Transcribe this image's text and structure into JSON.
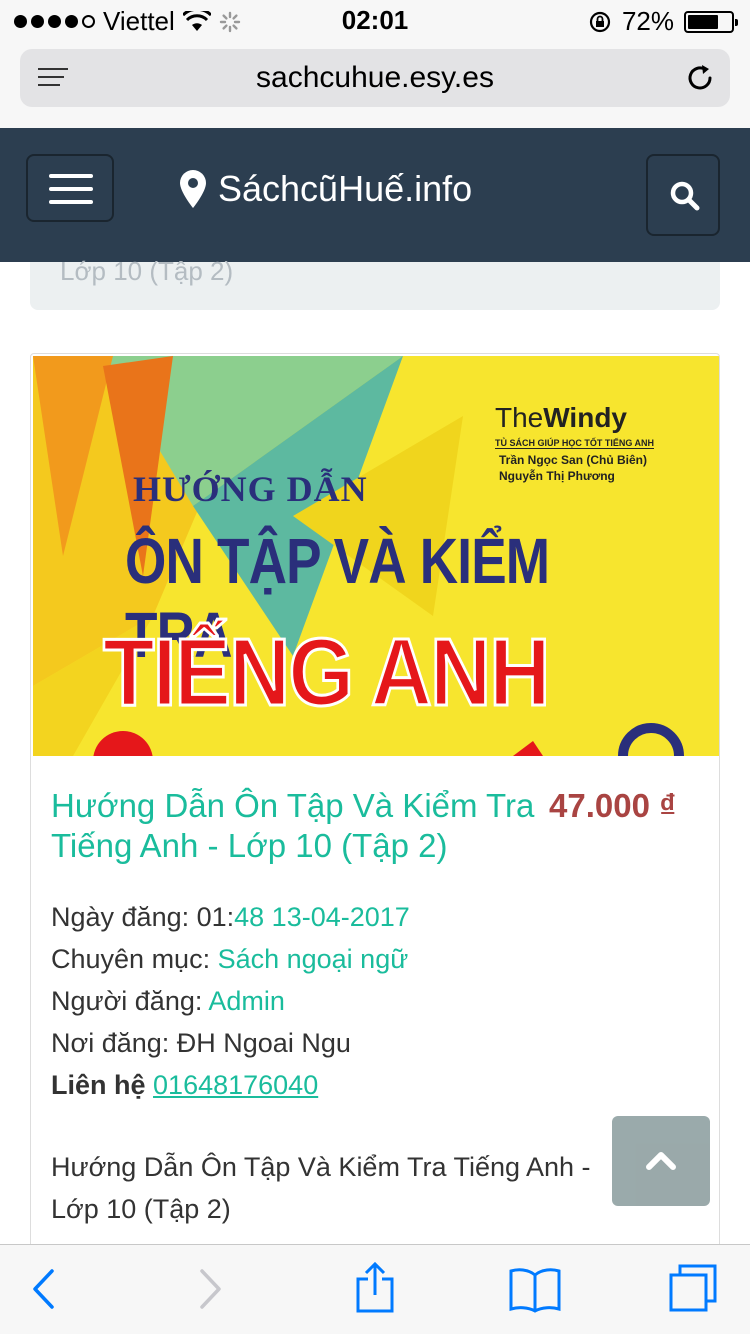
{
  "status_bar": {
    "carrier": "Viettel",
    "time": "02:01",
    "battery": "72%",
    "battery_level": 0.72
  },
  "browser": {
    "url": "sachcuhue.esy.es"
  },
  "site": {
    "brand": "SáchcũHuế.info"
  },
  "breadcrumb_fragment": "Lớp 10 (Tập 2)",
  "book_cover": {
    "logo_the": "The",
    "logo_windy": "Windy",
    "logo_tag": "TỦ SÁCH GIÚP HỌC TỐT TIẾNG ANH",
    "author_1": "Trần Ngọc San (Chủ Biên)",
    "author_2": "Nguyễn Thị Phương",
    "line_1": "HƯỚNG DẪN",
    "line_2": "ÔN TẬP VÀ KIỂM TRA",
    "line_3": "TIẾNG ANH"
  },
  "product": {
    "title": "Hướng Dẫn Ôn Tập Và Kiểm Tra Tiếng Anh - Lớp 10 (Tập 2)",
    "price": "47.000 ₫",
    "date_label": "Ngày đăng: 01:",
    "date_value": "48 13-04-2017",
    "category_label": "Chuyên mục: ",
    "category_value": "Sách ngoại ngữ",
    "poster_label": "Người đăng: ",
    "poster_value": "Admin",
    "location_label": "Nơi đăng: ",
    "location_value": "ĐH Ngoai Ngu",
    "contact_label": "Liên hệ",
    "contact_value": "01648176040",
    "description": "Hướng Dẫn Ôn Tập Và Kiểm Tra Tiếng Anh - Lớp 10 (Tập 2)"
  },
  "icons": {
    "menu": "hamburger-icon",
    "location": "map-marker-icon",
    "search": "search-icon",
    "back_to_top": "chevron-up-icon",
    "reload": "reload-icon",
    "reader": "reader-icon",
    "back": "chevron-left-icon",
    "forward": "chevron-right-icon",
    "share": "share-icon",
    "bookmarks": "book-icon",
    "tabs": "tabs-icon"
  },
  "colors": {
    "nav_bg": "#2c3e50",
    "link": "#1abc9c",
    "price": "#a94442",
    "ios_blue": "#007aff",
    "cover_yellow": "#f7e52e"
  }
}
